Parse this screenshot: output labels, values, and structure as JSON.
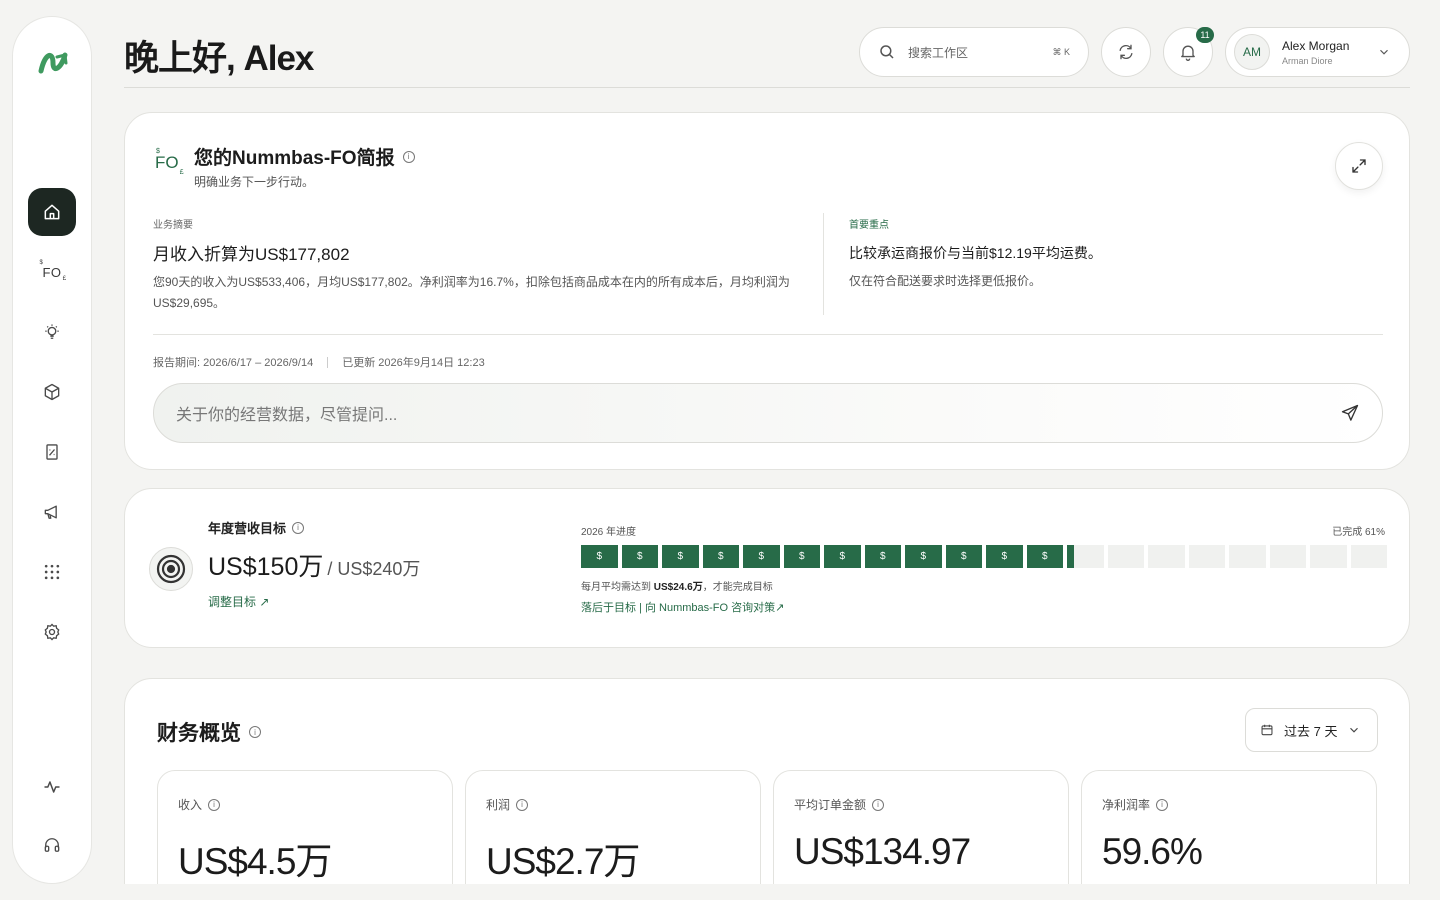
{
  "header": {
    "greeting": "晚上好, Alex",
    "search_placeholder": "搜索工作区",
    "search_shortcut": "⌘ K",
    "notification_count": "11",
    "user": {
      "initials": "AM",
      "name": "Alex Morgan",
      "org": "Arman Diore"
    }
  },
  "sidebar": {
    "items": [
      "home",
      "fo",
      "insights",
      "products",
      "reports",
      "marketing",
      "apps",
      "settings",
      "activity",
      "support"
    ],
    "fo_label": "FO"
  },
  "brief": {
    "logo_text": "FO",
    "title": "您的Nummbas-FO简报",
    "subtitle": "明确业务下一步行动。",
    "summary_label": "业务摘要",
    "summary_head": "月收入折算为US$177,802",
    "summary_body": "您90天的收入为US$533,406，月均US$177,802。净利润率为16.7%，扣除包括商品成本在内的所有成本后，月均利润为US$29,695。",
    "focus_label": "首要重点",
    "focus_head": "比较承运商报价与当前$12.19平均运费。",
    "focus_body": "仅在符合配送要求时选择更低报价。",
    "period": "报告期间:  2026/6/17 – 2026/9/14",
    "updated": "已更新 2026年9月14日 12:23",
    "ask_placeholder": "关于你的经营数据，尽管提问..."
  },
  "goal": {
    "label": "年度营收目标",
    "current": "US$150万",
    "target": "/ US$240万",
    "adjust": "调整目标 ↗",
    "progress_label": "2026 年进度",
    "progress_done": "已完成 61%",
    "progress": 0.61,
    "segments": 20,
    "segment_symbol": "$",
    "note_prefix": "每月平均需达到",
    "note_amount": "US$24.6万",
    "note_suffix": "，才能完成目标",
    "link": "落后于目标 | 向 Nummbas-FO 咨询对策↗"
  },
  "finance": {
    "title": "财务概览",
    "range": "过去 7 天",
    "kpis": [
      {
        "label": "收入",
        "value": "US$4.5万"
      },
      {
        "label": "利润",
        "value": "US$2.7万"
      },
      {
        "label": "平均订单金额",
        "value": "US$134.97"
      },
      {
        "label": "净利润率",
        "value": "59.6%"
      }
    ]
  },
  "colors": {
    "accent": "#276b48",
    "dark": "#1d2722",
    "background": "#f4f4f2"
  }
}
